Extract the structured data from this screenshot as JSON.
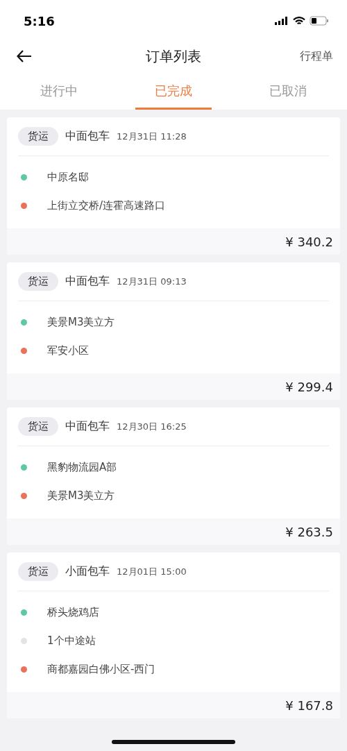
{
  "status_bar": {
    "time": "5:16"
  },
  "header": {
    "title": "订单列表",
    "action": "行程单"
  },
  "tabs": [
    {
      "label": "进行中",
      "selected": false
    },
    {
      "label": "已完成",
      "selected": true
    },
    {
      "label": "已取消",
      "selected": false
    }
  ],
  "orders": [
    {
      "tag": "货运",
      "vehicle": "中面包车",
      "time": "12月31日 11:28",
      "stops": [
        {
          "name": "中原名邸",
          "color": "#5ec8a4"
        },
        {
          "name": "上街立交桥/连霍高速路口",
          "color": "#e8735a"
        }
      ],
      "price": "¥ 340.2"
    },
    {
      "tag": "货运",
      "vehicle": "中面包车",
      "time": "12月31日 09:13",
      "stops": [
        {
          "name": "美景M3美立方",
          "color": "#5ec8a4"
        },
        {
          "name": "军安小区",
          "color": "#e8735a"
        }
      ],
      "price": "¥ 299.4"
    },
    {
      "tag": "货运",
      "vehicle": "中面包车",
      "time": "12月30日 16:25",
      "stops": [
        {
          "name": "黑豹物流园A部",
          "color": "#5ec8a4"
        },
        {
          "name": "美景M3美立方",
          "color": "#e8735a"
        }
      ],
      "price": "¥ 263.5"
    },
    {
      "tag": "货运",
      "vehicle": "小面包车",
      "time": "12月01日 15:00",
      "stops": [
        {
          "name": "桥头烧鸡店",
          "color": "#5ec8a4"
        },
        {
          "name": "1个中途站",
          "color": "#e4e4e6"
        },
        {
          "name": "商都嘉园白佛小区-西门",
          "color": "#e8735a"
        }
      ],
      "price": "¥ 167.8"
    }
  ]
}
